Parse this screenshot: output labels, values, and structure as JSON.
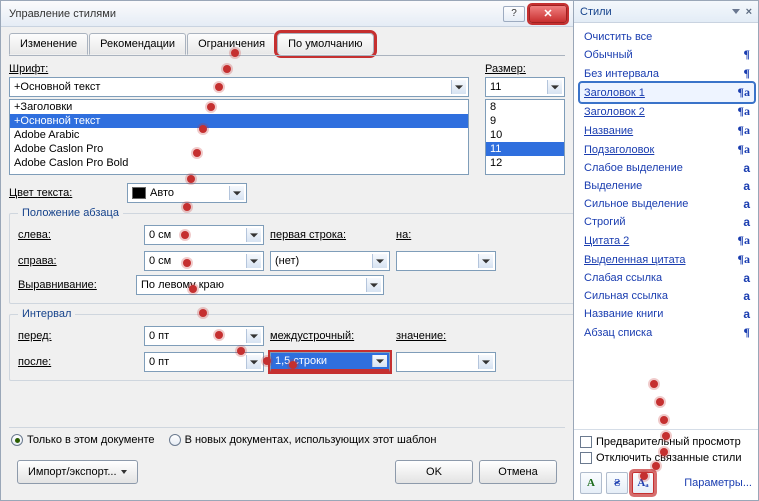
{
  "dialog": {
    "title": "Управление стилями",
    "tabs": [
      "Изменение",
      "Рекомендации",
      "Ограничения",
      "По умолчанию"
    ],
    "font_label": "Шрифт:",
    "size_label": "Размер:",
    "font_value": "+Основной текст",
    "size_value": "11",
    "font_list": [
      "+Заголовки",
      "+Основной текст",
      "Adobe Arabic",
      "Adobe Caslon Pro",
      "Adobe Caslon Pro Bold"
    ],
    "font_selected_index": 1,
    "size_list": [
      "8",
      "9",
      "10",
      "11",
      "12"
    ],
    "size_selected_index": 3,
    "font_color_label": "Цвет текста:",
    "font_color_value": "Авто",
    "para_legend": "Положение абзаца",
    "left_label": "слева:",
    "right_label": "справа:",
    "first_line_label": "первая строка:",
    "by_label": "на:",
    "left_value": "0 см",
    "right_value": "0 см",
    "first_line_value": "(нет)",
    "by_value": "",
    "align_label": "Выравнивание:",
    "align_value": "По левому краю",
    "spacing_legend": "Интервал",
    "before_label": "перед:",
    "after_label": "после:",
    "line_label": "междустрочный:",
    "at_label": "значение:",
    "before_value": "0 пт",
    "after_value": "0 пт",
    "line_value": "1,5 строки",
    "at_value": "",
    "radio_doc": "Только в этом документе",
    "radio_template": "В новых документах, использующих этот шаблон",
    "import_export": "Импорт/экспорт...",
    "ok": "OK",
    "cancel": "Отмена"
  },
  "pane": {
    "title": "Стили",
    "items": [
      {
        "label": "Очистить все",
        "glyph": ""
      },
      {
        "label": "Обычный",
        "glyph": "¶"
      },
      {
        "label": "Без интервала",
        "glyph": "¶"
      },
      {
        "label": "Заголовок 1",
        "glyph": "¶a",
        "boxed": true,
        "u": true
      },
      {
        "label": "Заголовок 2",
        "glyph": "¶a",
        "u": true
      },
      {
        "label": "Название",
        "glyph": "¶a",
        "u": true
      },
      {
        "label": "Подзаголовок",
        "glyph": "¶a",
        "u": true
      },
      {
        "label": "Слабое выделение",
        "glyph": "a"
      },
      {
        "label": "Выделение",
        "glyph": "a"
      },
      {
        "label": "Сильное выделение",
        "glyph": "a"
      },
      {
        "label": "Строгий",
        "glyph": "a"
      },
      {
        "label": "Цитата 2",
        "glyph": "¶a",
        "u": true
      },
      {
        "label": "Выделенная цитата",
        "glyph": "¶a",
        "u": true
      },
      {
        "label": "Слабая ссылка",
        "glyph": "a"
      },
      {
        "label": "Сильная ссылка",
        "glyph": "a"
      },
      {
        "label": "Название книги",
        "glyph": "a"
      },
      {
        "label": "Абзац списка",
        "glyph": "¶"
      }
    ],
    "preview_label": "Предварительный просмотр",
    "disable_linked_label": "Отключить связанные стили",
    "options_link": "Параметры..."
  }
}
